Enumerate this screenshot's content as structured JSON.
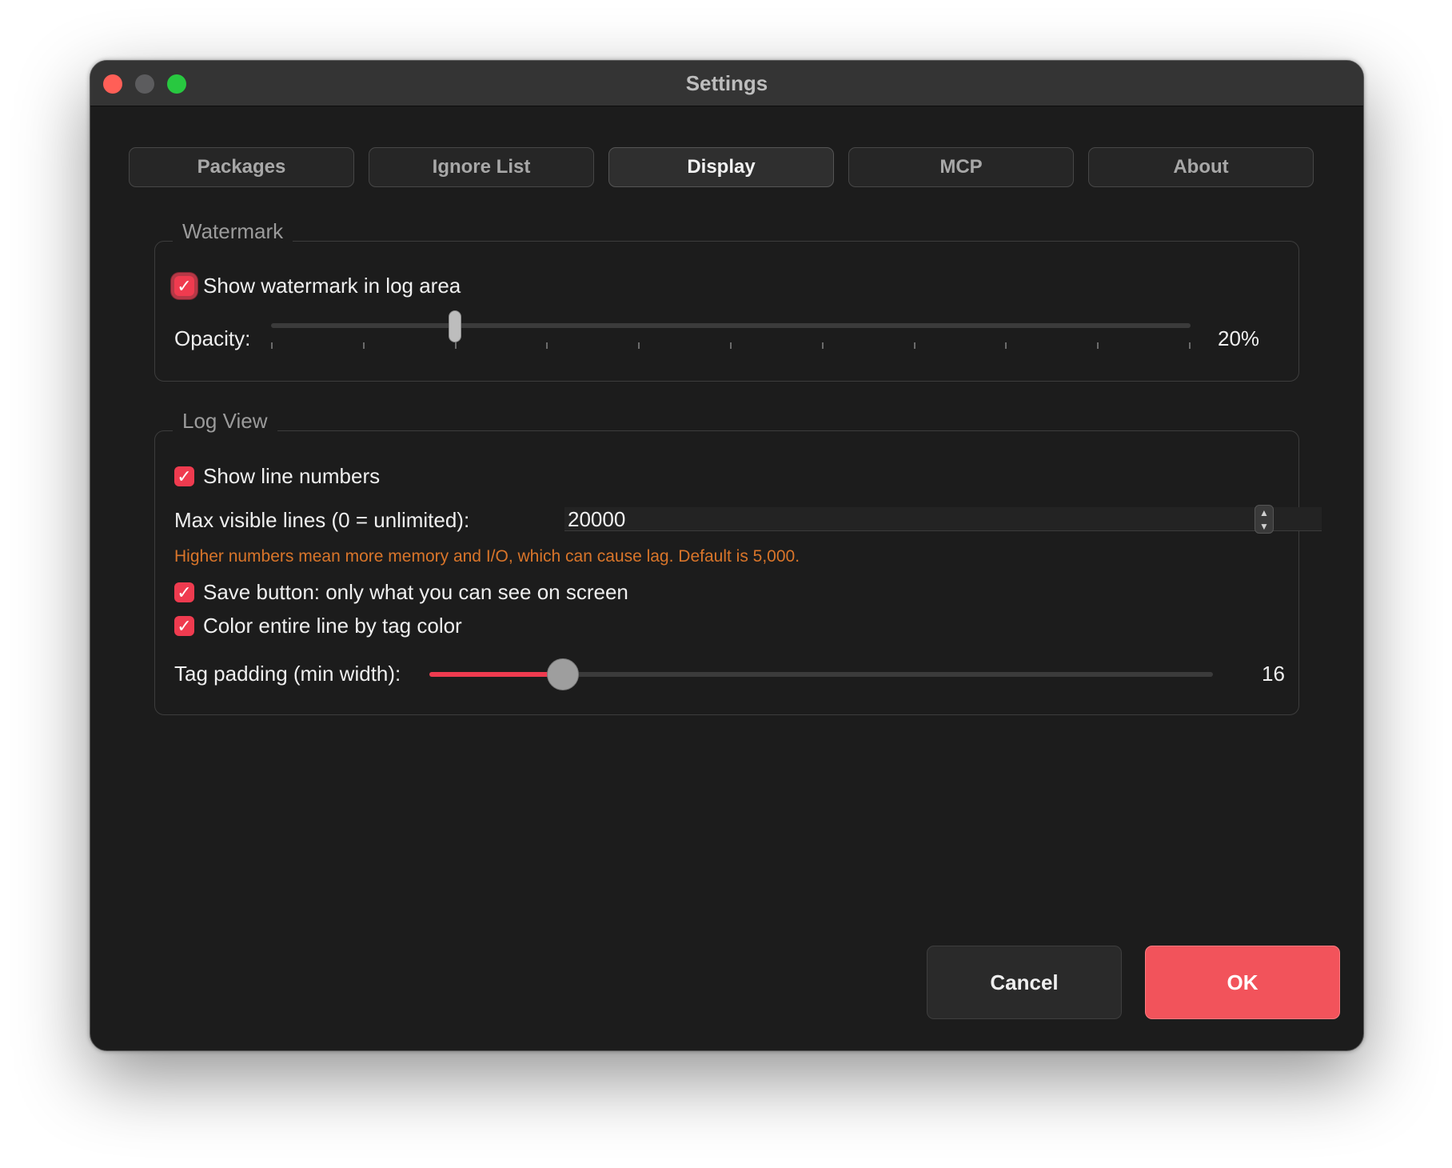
{
  "window": {
    "title": "Settings"
  },
  "tabs": [
    {
      "label": "Packages"
    },
    {
      "label": "Ignore List"
    },
    {
      "label": "Display",
      "active": true
    },
    {
      "label": "MCP"
    },
    {
      "label": "About"
    }
  ],
  "watermark": {
    "group_title": "Watermark",
    "show_label": "Show watermark in log area",
    "show_checked": true,
    "opacity_label": "Opacity:",
    "opacity_value": 20,
    "opacity_text": "20%"
  },
  "log_view": {
    "group_title": "Log View",
    "line_numbers_label": "Show line numbers",
    "line_numbers_checked": true,
    "max_lines_label": "Max visible lines (0 = unlimited):",
    "max_lines_value": "20000",
    "warning": "Higher numbers mean more memory and I/O, which can cause lag. Default is 5,000.",
    "save_visible_label": "Save button: only what you can see on screen",
    "save_visible_checked": true,
    "color_line_label": "Color entire line by tag color",
    "color_line_checked": true,
    "tag_padding_label": "Tag padding (min width):",
    "tag_padding_value": "16",
    "tag_padding_fraction": 0.17
  },
  "buttons": {
    "cancel": "Cancel",
    "ok": "OK"
  },
  "colors": {
    "accent": "#ef3b4f",
    "ok_button": "#f2535b",
    "warning": "#d9752a",
    "window_bg": "#1c1c1c"
  },
  "icons": {
    "checkmark": "checkmark-icon",
    "stepper": "chevron-up-down-icon"
  }
}
